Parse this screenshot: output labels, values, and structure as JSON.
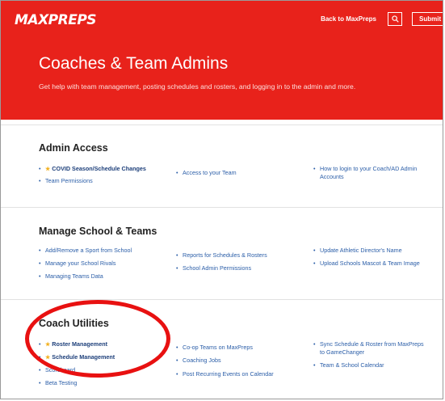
{
  "header": {
    "logo": "MAXPREPS",
    "back_link": "Back to MaxPreps",
    "submit_label": "Submit a re"
  },
  "hero": {
    "title": "Coaches & Team Admins",
    "subtitle": "Get help with team management, posting schedules and rosters, and logging in to the admin and more."
  },
  "sections": {
    "admin_access": {
      "title": "Admin Access",
      "col1": [
        "COVID Season/Schedule Changes",
        "Team Permissions"
      ],
      "col2": [
        "Access to your Team"
      ],
      "col3": [
        "How to login to your Coach/AD Admin Accounts"
      ]
    },
    "manage_school": {
      "title": "Manage School & Teams",
      "col1": [
        "Add/Remove a Sport from School",
        "Manage your School Rivals",
        "Managing Teams Data"
      ],
      "col2": [
        "Reports for Schedules & Rosters",
        "School Admin Permissions"
      ],
      "col3": [
        "Update Athletic Director's Name",
        "Upload Schools Mascot & Team Image"
      ]
    },
    "coach_utilities": {
      "title": "Coach Utilities",
      "col1": [
        "Roster Management",
        "Schedule Management",
        "Scoreboard",
        "Beta Testing"
      ],
      "col2": [
        "Co-op Teams on MaxPreps",
        "Coaching Jobs",
        "Post Recurring Events on Calendar"
      ],
      "col3": [
        "Sync Schedule & Roster from MaxPreps to GameChanger",
        "Team & School Calendar"
      ]
    }
  },
  "colors": {
    "brand_red": "#e8221b",
    "link_blue": "#2b5ea8",
    "annotation_red": "#e81111"
  }
}
